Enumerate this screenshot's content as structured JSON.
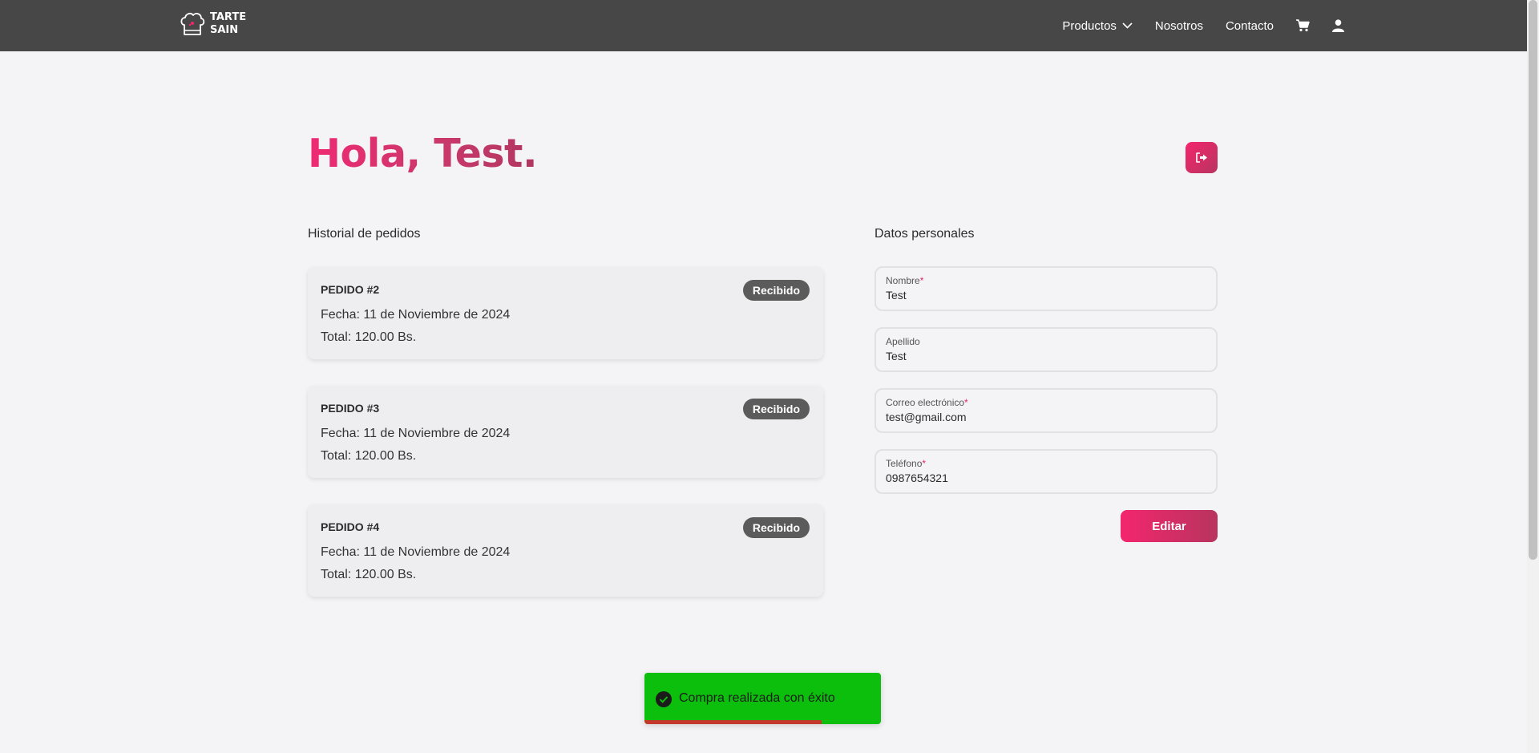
{
  "header": {
    "logo_line1": "TARTE",
    "logo_line2": "SAIN",
    "nav": {
      "productos": "Productos",
      "nosotros": "Nosotros",
      "contacto": "Contacto"
    }
  },
  "greeting": "Hola, Test.",
  "orders_section": {
    "title": "Historial de pedidos",
    "orders": [
      {
        "id": "PEDIDO #2",
        "date": "Fecha: 11 de Noviembre de 2024",
        "total": "Total: 120.00 Bs.",
        "status": "Recibido"
      },
      {
        "id": "PEDIDO #3",
        "date": "Fecha: 11 de Noviembre de 2024",
        "total": "Total: 120.00 Bs.",
        "status": "Recibido"
      },
      {
        "id": "PEDIDO #4",
        "date": "Fecha: 11 de Noviembre de 2024",
        "total": "Total: 120.00 Bs.",
        "status": "Recibido"
      }
    ]
  },
  "personal_section": {
    "title": "Datos personales",
    "fields": [
      {
        "label": "Nombre",
        "required": "*",
        "value": "Test"
      },
      {
        "label": "Apellido",
        "required": "",
        "value": "Test"
      },
      {
        "label": "Correo electrónico",
        "required": "*",
        "value": "test@gmail.com"
      },
      {
        "label": "Teléfono",
        "required": "*",
        "value": "0987654321"
      }
    ],
    "edit_label": "Editar"
  },
  "toast": {
    "message": "Compra realizada con éxito",
    "progress": 0.75
  },
  "colors": {
    "accent": "#f3266d",
    "accent_dark": "#b8345f",
    "header_bg": "#474747",
    "toast_bg": "#0cbf0c",
    "badge_bg": "#5b5b5b"
  }
}
